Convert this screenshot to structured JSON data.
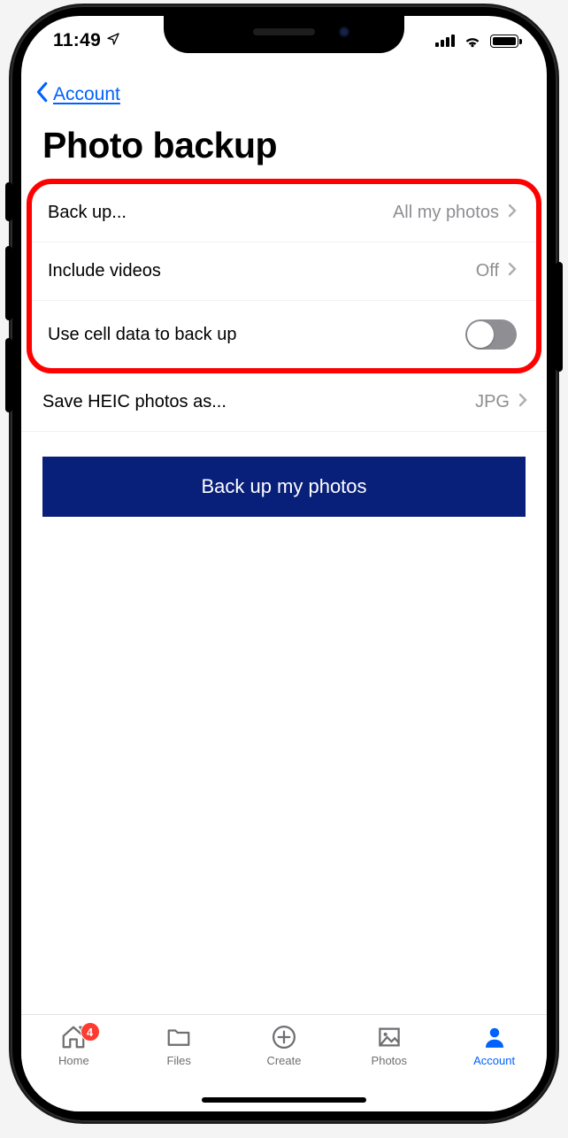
{
  "status": {
    "time": "11:49",
    "location_arrow": true,
    "signal_bars": 4,
    "wifi": true,
    "battery_full": true
  },
  "nav": {
    "back_label": "Account"
  },
  "page_title": "Photo backup",
  "settings": {
    "backup": {
      "label": "Back up...",
      "value": "All my photos"
    },
    "include_videos": {
      "label": "Include videos",
      "value": "Off"
    },
    "cell_data": {
      "label": "Use cell data to back up",
      "on": false
    },
    "heic": {
      "label": "Save HEIC photos as...",
      "value": "JPG"
    }
  },
  "primary_button": "Back up my photos",
  "tabs": [
    {
      "label": "Home",
      "icon": "home",
      "badge": "4"
    },
    {
      "label": "Files",
      "icon": "folder"
    },
    {
      "label": "Create",
      "icon": "plus-circle"
    },
    {
      "label": "Photos",
      "icon": "image"
    },
    {
      "label": "Account",
      "icon": "person",
      "active": true
    }
  ]
}
